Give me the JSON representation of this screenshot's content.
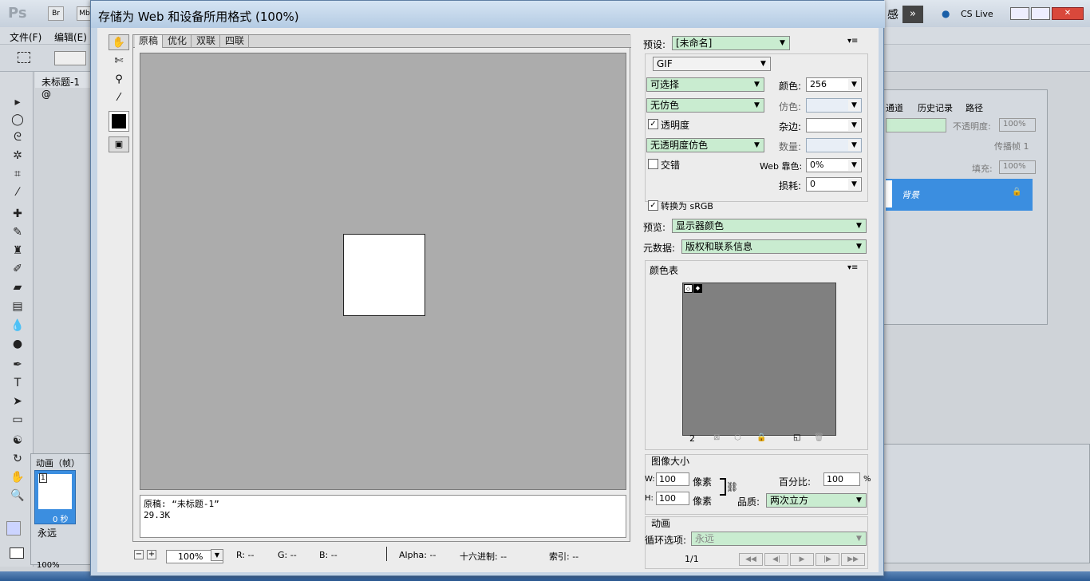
{
  "photoshop": {
    "logo": "Ps",
    "menus": [
      "文件(F)",
      "编辑(E)"
    ],
    "doc_tab": "未标题-1 @",
    "cs_live": "CS Live",
    "workspace_fragment": "感",
    "layers_tabs": [
      "通道",
      "历史记录",
      "路径"
    ],
    "opacity_label": "不透明度:",
    "opacity_value": "100%",
    "fill_label": "填充:",
    "fill_value": "100%",
    "propagate_label": "传播帧 1",
    "layer_name": "背景",
    "animation_tab": "动画（帧）",
    "frame_number": "1",
    "frame_delay": "0 秒",
    "loop_value": "永远",
    "zoom_status": "100%"
  },
  "dialog": {
    "title": "存储为 Web 和设备所用格式 (100%)",
    "tabs": [
      "原稿",
      "优化",
      "双联",
      "四联"
    ],
    "info_line1": "原稿: “未标题-1”",
    "info_line2": "29.3K",
    "zoom": "100%",
    "readouts": {
      "r": "R: --",
      "g": "G: --",
      "b": "B: --",
      "alpha": "Alpha: --",
      "hex": "十六进制: --",
      "index": "索引: --"
    },
    "preset_label": "预设:",
    "preset_value": "[未命名]",
    "format": "GIF",
    "reduction": "可选择",
    "colors_label": "颜色:",
    "colors_value": "256",
    "dither_algo": "无仿色",
    "dither_label": "仿色:",
    "transparency_label": "透明度",
    "matte_label": "杂边:",
    "trans_dither": "无透明度仿色",
    "amount_label": "数量:",
    "interlaced_label": "交错",
    "web_snap_label": "Web 靠色:",
    "web_snap_value": "0%",
    "lossy_label": "损耗:",
    "lossy_value": "0",
    "convert_srgb_label": "转换为 sRGB",
    "preview_label": "预览:",
    "preview_value": "显示器颜色",
    "metadata_label": "元数据:",
    "metadata_value": "版权和联系信息",
    "color_table_title": "颜色表",
    "color_count": "2",
    "image_size_title": "图像大小",
    "w_label": "W:",
    "w_value": "100",
    "h_label": "H:",
    "h_value": "100",
    "px_unit": "像素",
    "percent_label": "百分比:",
    "percent_value": "100",
    "percent_unit": "%",
    "quality_label": "品质:",
    "quality_value": "两次立方",
    "animation_title": "动画",
    "loop_label": "循环选项:",
    "loop_value": "永远",
    "frame_counter": "1/1"
  },
  "colors": {
    "dropdown_green": "#c9ecd0",
    "layer_selected": "#3b8ee0",
    "preview_gray": "#acacac",
    "color_table_bg": "#808080"
  }
}
